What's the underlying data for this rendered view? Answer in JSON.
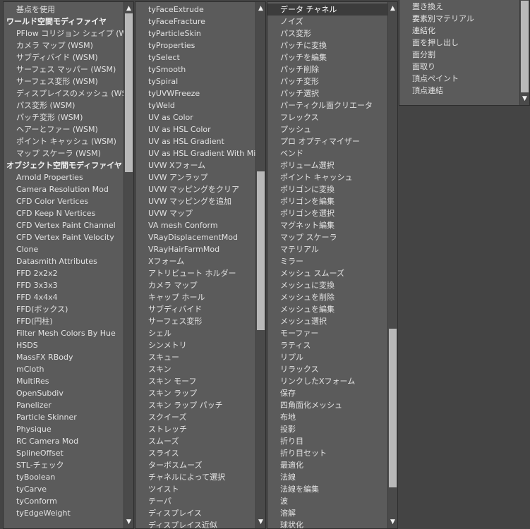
{
  "col1": {
    "items": [
      {
        "label": "基点を使用",
        "type": "option"
      },
      {
        "label": "ワールド空間モディファイヤ",
        "type": "header"
      },
      {
        "label": "PFlow コリジョン シェイプ (WSM)"
      },
      {
        "label": "カメラ マップ (WSM)"
      },
      {
        "label": "サブディバイド (WSM)"
      },
      {
        "label": "サーフェス マッパー (WSM)"
      },
      {
        "label": "サーフェス変形 (WSM)"
      },
      {
        "label": "ディスプレイスのメッシュ (WSM)"
      },
      {
        "label": "パス変形 (WSM)"
      },
      {
        "label": "パッチ変形 (WSM)"
      },
      {
        "label": "ヘアーとファー (WSM)"
      },
      {
        "label": "ポイント キャッシュ (WSM)"
      },
      {
        "label": "マップ スケーラ (WSM)"
      },
      {
        "label": "オブジェクト空間モディファイヤ",
        "type": "header"
      },
      {
        "label": "Arnold Properties"
      },
      {
        "label": "Camera Resolution Mod"
      },
      {
        "label": "CFD Color Vertices"
      },
      {
        "label": "CFD Keep N Vertices"
      },
      {
        "label": "CFD Vertex Paint Channel"
      },
      {
        "label": "CFD Vertex Paint Velocity"
      },
      {
        "label": "Clone"
      },
      {
        "label": "Datasmith Attributes"
      },
      {
        "label": "FFD 2x2x2"
      },
      {
        "label": "FFD 3x3x3"
      },
      {
        "label": "FFD 4x4x4"
      },
      {
        "label": "FFD(ボックス)"
      },
      {
        "label": "FFD(円柱)"
      },
      {
        "label": "Filter Mesh Colors By Hue"
      },
      {
        "label": "HSDS"
      },
      {
        "label": "MassFX RBody"
      },
      {
        "label": "mCloth"
      },
      {
        "label": "MultiRes"
      },
      {
        "label": "OpenSubdiv"
      },
      {
        "label": "Panelizer"
      },
      {
        "label": "Particle Skinner"
      },
      {
        "label": "Physique"
      },
      {
        "label": "RC Camera Mod"
      },
      {
        "label": "SplineOffset"
      },
      {
        "label": "STL-チェック"
      },
      {
        "label": "tyBoolean"
      },
      {
        "label": "tyCarve"
      },
      {
        "label": "tyConform"
      },
      {
        "label": "tyEdgeWeight"
      }
    ]
  },
  "col2": {
    "items": [
      {
        "label": "tyFaceExtrude"
      },
      {
        "label": "tyFaceFracture"
      },
      {
        "label": "tyParticleSkin"
      },
      {
        "label": "tyProperties"
      },
      {
        "label": "tySelect"
      },
      {
        "label": "tySmooth"
      },
      {
        "label": "tySpiral"
      },
      {
        "label": "tyUVWFreeze"
      },
      {
        "label": "tyWeld"
      },
      {
        "label": "UV as Color"
      },
      {
        "label": "UV as HSL Color"
      },
      {
        "label": "UV as HSL Gradient"
      },
      {
        "label": "UV as HSL Gradient With Midpoint"
      },
      {
        "label": "UVW Xフォーム"
      },
      {
        "label": "UVW アンラップ"
      },
      {
        "label": "UVW マッピングをクリア"
      },
      {
        "label": "UVW マッピングを追加"
      },
      {
        "label": "UVW マップ"
      },
      {
        "label": "VA mesh Conform"
      },
      {
        "label": "VRayDisplacementMod"
      },
      {
        "label": "VRayHairFarmMod"
      },
      {
        "label": "Xフォーム"
      },
      {
        "label": "アトリビュート ホルダー"
      },
      {
        "label": "カメラ マップ"
      },
      {
        "label": "キャップ ホール"
      },
      {
        "label": "サブディバイド"
      },
      {
        "label": "サーフェス変形"
      },
      {
        "label": "シェル"
      },
      {
        "label": "シンメトリ"
      },
      {
        "label": "スキュー"
      },
      {
        "label": "スキン"
      },
      {
        "label": "スキン モーフ"
      },
      {
        "label": "スキン ラップ"
      },
      {
        "label": "スキン ラップ パッチ"
      },
      {
        "label": "スクイーズ"
      },
      {
        "label": "ストレッチ"
      },
      {
        "label": "スムーズ"
      },
      {
        "label": "スライス"
      },
      {
        "label": "ターボスムーズ"
      },
      {
        "label": "チャネルによって選択"
      },
      {
        "label": "ツイスト"
      },
      {
        "label": "テーパ"
      },
      {
        "label": "ディスプレイス"
      },
      {
        "label": "ディスプレイス近似"
      }
    ]
  },
  "col3": {
    "items": [
      {
        "label": "データ チャネル",
        "type": "selected"
      },
      {
        "label": "ノイズ"
      },
      {
        "label": "パス変形"
      },
      {
        "label": "パッチに変換"
      },
      {
        "label": "パッチを編集"
      },
      {
        "label": "パッチ削除"
      },
      {
        "label": "パッチ変形"
      },
      {
        "label": "パッチ選択"
      },
      {
        "label": "パーティクル面クリエータ"
      },
      {
        "label": "フレックス"
      },
      {
        "label": "プッシュ"
      },
      {
        "label": "プロ オプティマイザー"
      },
      {
        "label": "ベンド"
      },
      {
        "label": "ボリューム選択"
      },
      {
        "label": "ポイント キャッシュ"
      },
      {
        "label": "ポリゴンに変換"
      },
      {
        "label": "ポリゴンを編集"
      },
      {
        "label": "ポリゴンを選択"
      },
      {
        "label": "マグネット編集"
      },
      {
        "label": "マップ スケーラ"
      },
      {
        "label": "マテリアル"
      },
      {
        "label": "ミラー"
      },
      {
        "label": "メッシュ スムーズ"
      },
      {
        "label": "メッシュに変換"
      },
      {
        "label": "メッシュを削除"
      },
      {
        "label": "メッシュを編集"
      },
      {
        "label": "メッシュ選択"
      },
      {
        "label": "モーファー"
      },
      {
        "label": "ラティス"
      },
      {
        "label": "リプル"
      },
      {
        "label": "リラックス"
      },
      {
        "label": "リンクしたXフォーム"
      },
      {
        "label": "保存"
      },
      {
        "label": "四角面化メッシュ"
      },
      {
        "label": "布地"
      },
      {
        "label": "投影"
      },
      {
        "label": "折り目"
      },
      {
        "label": "折り目セット"
      },
      {
        "label": "最適化"
      },
      {
        "label": "法線"
      },
      {
        "label": "法線を編集"
      },
      {
        "label": "波"
      },
      {
        "label": "溶解"
      },
      {
        "label": "球状化"
      }
    ]
  },
  "col4": {
    "items": [
      {
        "label": "置き換え"
      },
      {
        "label": "要素別マテリアル"
      },
      {
        "label": "連結化"
      },
      {
        "label": "面を押し出し"
      },
      {
        "label": "面分割"
      },
      {
        "label": "面取り"
      },
      {
        "label": "頂点ペイント"
      },
      {
        "label": "頂点連結"
      }
    ]
  },
  "icons": {
    "up": "scroll-up-arrow-icon",
    "down": "scroll-down-arrow-icon"
  },
  "colors": {
    "panel": "#5b5b5b",
    "background": "#444444",
    "selected": "#3c3c3c",
    "text": "#e2e2e2",
    "thumb": "#b9b9b9"
  }
}
